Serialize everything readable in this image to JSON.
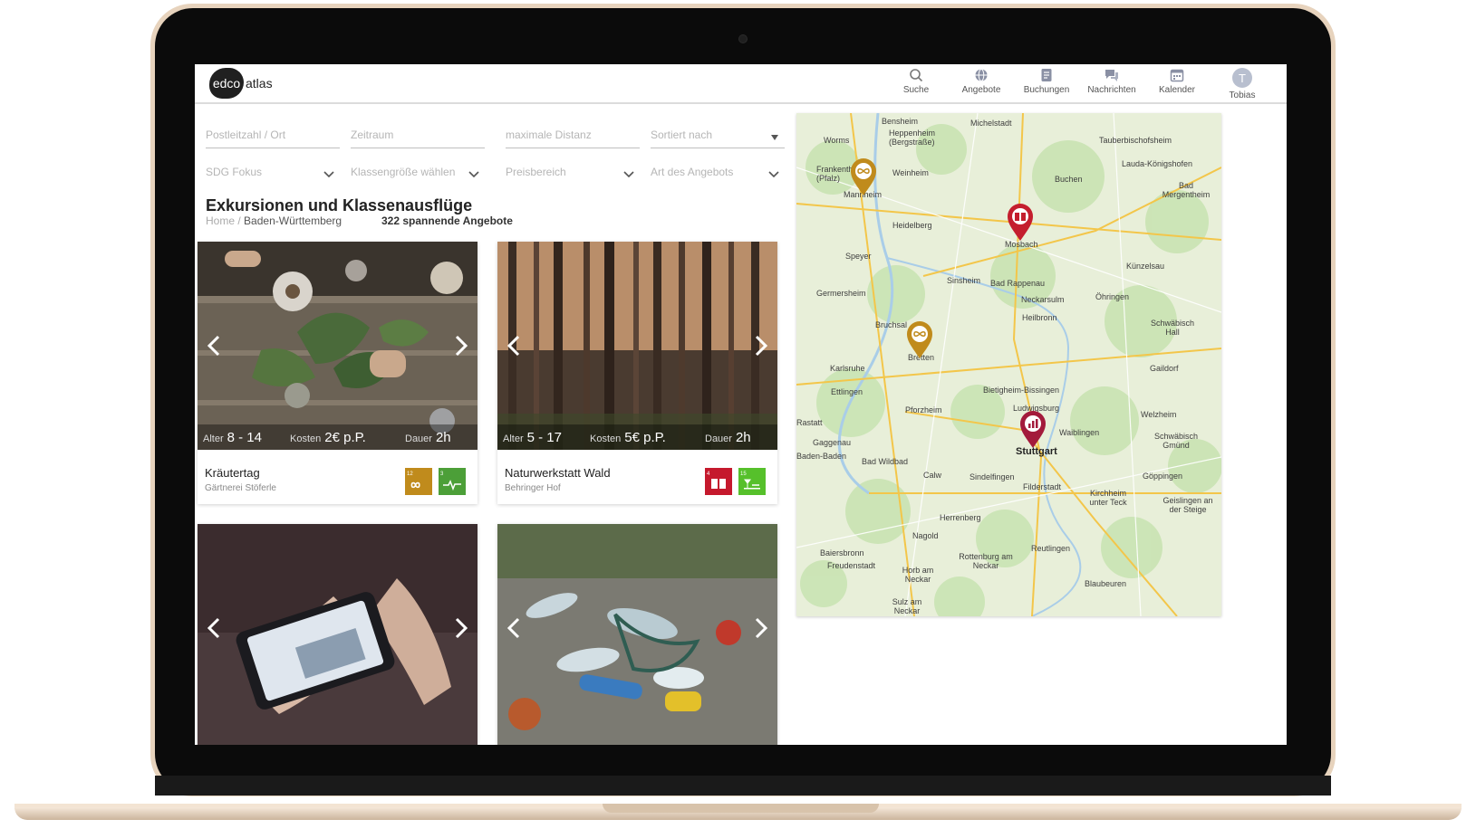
{
  "app": {
    "logo_left": "edco",
    "logo_right": "atlas"
  },
  "nav": [
    {
      "label": "Suche",
      "icon": "search-icon"
    },
    {
      "label": "Angebote",
      "icon": "globe-icon"
    },
    {
      "label": "Buchungen",
      "icon": "document-icon"
    },
    {
      "label": "Nachrichten",
      "icon": "chat-icon"
    },
    {
      "label": "Kalender",
      "icon": "calendar-icon"
    },
    {
      "label": "Tobias",
      "avatar_initial": "T"
    }
  ],
  "filters": {
    "row1": [
      {
        "placeholder": "Postleitzahl / Ort"
      },
      {
        "placeholder": "Zeitraum"
      },
      {
        "placeholder": "maximale Distanz"
      },
      {
        "placeholder": "Sortiert nach"
      }
    ],
    "row2": [
      {
        "placeholder": "SDG Fokus"
      },
      {
        "placeholder": "Klassengröße wählen"
      },
      {
        "placeholder": "Preisbereich"
      },
      {
        "placeholder": "Art des Angebots"
      }
    ]
  },
  "results": {
    "heading": "Exkursionen und Klassenausflüge",
    "breadcrumb_home": "Home",
    "breadcrumb_sep": "/",
    "breadcrumb_region": "Baden-Württemberg",
    "count_text": "322 spannende Angebote"
  },
  "stat_labels": {
    "age": "Alter",
    "cost": "Kosten",
    "duration": "Dauer"
  },
  "cards": [
    {
      "age": "8 - 14",
      "cost": "2€ p.P.",
      "duration": "2h",
      "title": "Kräutertag",
      "provider": "Gärtnerei Stöferle",
      "sdgs": [
        "12",
        "3"
      ]
    },
    {
      "age": "5 - 17",
      "cost": "5€ p.P.",
      "duration": "2h",
      "title": "Naturwerkstatt Wald",
      "provider": "Behringer Hof",
      "sdgs": [
        "4",
        "15"
      ]
    }
  ],
  "map": {
    "cities": [
      {
        "name": "Bensheim"
      },
      {
        "name": "Michelstadt"
      },
      {
        "name": "Worms"
      },
      {
        "name": "Heppenheim (Bergstraße)"
      },
      {
        "name": "Tauberbischofsheim"
      },
      {
        "name": "Frankenthal (Pfalz)"
      },
      {
        "name": "Weinheim"
      },
      {
        "name": "Lauda-Königshofen"
      },
      {
        "name": "Mannheim"
      },
      {
        "name": "Buchen"
      },
      {
        "name": "Bad Mergentheim"
      },
      {
        "name": "Heidelberg"
      },
      {
        "name": "Mosbach"
      },
      {
        "name": "Speyer"
      },
      {
        "name": "Künzelsau"
      },
      {
        "name": "Sinsheim"
      },
      {
        "name": "Bad Rappenau"
      },
      {
        "name": "Germersheim"
      },
      {
        "name": "Neckarsulm"
      },
      {
        "name": "Öhringen"
      },
      {
        "name": "Heilbronn"
      },
      {
        "name": "Bruchsal"
      },
      {
        "name": "Schwäbisch Hall"
      },
      {
        "name": "Bretten"
      },
      {
        "name": "Karlsruhe"
      },
      {
        "name": "Gaildorf"
      },
      {
        "name": "Ettlingen"
      },
      {
        "name": "Bietigheim-Bissingen"
      },
      {
        "name": "Pforzheim"
      },
      {
        "name": "Ludwigsburg"
      },
      {
        "name": "Welzheim"
      },
      {
        "name": "Waiblingen"
      },
      {
        "name": "Schwäbisch Gmünd"
      },
      {
        "name": "Gaggenau"
      },
      {
        "name": "Stuttgart"
      },
      {
        "name": "Baden-Baden"
      },
      {
        "name": "Bad Wildbad"
      },
      {
        "name": "Calw"
      },
      {
        "name": "Sindelfingen"
      },
      {
        "name": "Göppingen"
      },
      {
        "name": "Filderstadt"
      },
      {
        "name": "Kirchheim unter Teck"
      },
      {
        "name": "Geislingen an der Steige"
      },
      {
        "name": "Herrenberg"
      },
      {
        "name": "Nagold"
      },
      {
        "name": "Reutlingen"
      },
      {
        "name": "Baiersbronn"
      },
      {
        "name": "Rottenburg am Neckar"
      },
      {
        "name": "Freudenstadt"
      },
      {
        "name": "Horb am Neckar"
      },
      {
        "name": "Blaubeuren"
      },
      {
        "name": "Sulz am Neckar"
      },
      {
        "name": "Rastatt"
      }
    ],
    "pins": [
      {
        "type": "sdg12-pin",
        "color": "#c08b1c"
      },
      {
        "type": "sdg4-pin",
        "color": "#c41e2e"
      },
      {
        "type": "sdg12-pin",
        "color": "#c08b1c"
      },
      {
        "type": "sdg8-pin",
        "color": "#a31a3b"
      }
    ]
  },
  "colors": {
    "sdg12": "#c08b1c",
    "sdg3": "#4c9f38",
    "sdg4": "#c5192d",
    "sdg15": "#56c02b"
  }
}
